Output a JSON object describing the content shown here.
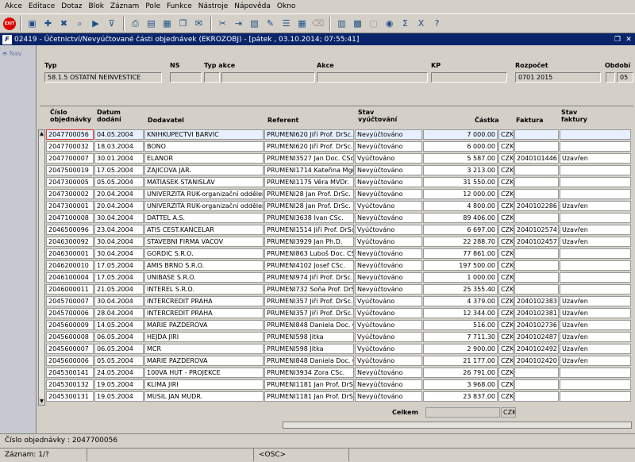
{
  "menu": [
    "Akce",
    "Editace",
    "Dotaz",
    "Blok",
    "Záznam",
    "Pole",
    "Funkce",
    "Nástroje",
    "Nápověda",
    "Okno"
  ],
  "toolbar_icons": [
    "exit-icon",
    "save-icon",
    "add-record-icon",
    "delete-record-icon",
    "search-icon",
    "execute-query-icon",
    "filter-icon",
    "print-icon",
    "report-icon",
    "preview-icon",
    "copy-icon",
    "email-icon",
    "cut-icon",
    "insert-icon",
    "paste-icon",
    "edit-icon",
    "list-icon",
    "table-icon",
    "clear-icon",
    "calendar-icon",
    "calculator-icon",
    "form-icon",
    "lock-icon",
    "sum-icon",
    "excel-icon",
    "help-icon"
  ],
  "window": {
    "logo": "F",
    "title": "02419 - Účetnictví/Nevyúčtované části objednávek (EKROZOBJ) - [pátek , 03.10.2014; 07:55:41]"
  },
  "nav": {
    "label": "Nav"
  },
  "header": {
    "typ_label": "Typ",
    "typ_value": "58.1.5 OSTATNÍ NEINVESTICE",
    "ns_label": "NS",
    "typ_akce_label": "Typ akce",
    "akce_label": "Akce",
    "kp_label": "KP",
    "rozpocet_label": "Rozpočet",
    "rozpocet_value": "0701 2015",
    "obdobi_label": "Období",
    "obdobi_value": "05"
  },
  "columns": {
    "cislo1": "Číslo",
    "cislo2": "objednávky",
    "datum1": "Datum",
    "datum2": "dodání",
    "dodavatel": "Dodavatel",
    "referent": "Referent",
    "stav1": "Stav",
    "stav2": "vyúčtování",
    "castka": "Částka",
    "faktura": "Faktura",
    "stavf1": "Stav",
    "stavf2": "faktury"
  },
  "rows": [
    {
      "cislo": "2047700056",
      "datum": "04.05.2004",
      "dodavatel": "KNIHKUPECTVI BARVIC",
      "referent": "PRUMENI620 Jiří Prof. DrSc.",
      "stav": "Nevyúčtováno",
      "castka": "7 000.00",
      "mena": "CZK",
      "faktura": "",
      "stavf": ""
    },
    {
      "cislo": "2047700032",
      "datum": "18.03.2004",
      "dodavatel": "BONO",
      "referent": "PRUMENI620 Jiří Prof. DrSc.",
      "stav": "Nevyúčtováno",
      "castka": "6 000.00",
      "mena": "CZK",
      "faktura": "",
      "stavf": ""
    },
    {
      "cislo": "2047700007",
      "datum": "30.01.2004",
      "dodavatel": "ELANOR",
      "referent": "PRUMENI3527 Jan Doc. CSc.",
      "stav": "Vyúčtováno",
      "castka": "5 587.00",
      "mena": "CZK",
      "faktura": "2040101446",
      "stavf": "Uzavřen"
    },
    {
      "cislo": "2047500019",
      "datum": "17.05.2004",
      "dodavatel": "ZAJICOVA JAR.",
      "referent": "PRUMENI1714 Kateřina Mgr.D",
      "stav": "Nevyúčtováno",
      "castka": "3 213.00",
      "mena": "CZK",
      "faktura": "",
      "stavf": ""
    },
    {
      "cislo": "2047300005",
      "datum": "05.05.2004",
      "dodavatel": "MATIASEK STANISLAV",
      "referent": "PRUMENI1175 Věra MVDr.",
      "stav": "Nevyúčtováno",
      "castka": "31 550.00",
      "mena": "CZK",
      "faktura": "",
      "stavf": ""
    },
    {
      "cislo": "2047300002",
      "datum": "20.04.2004",
      "dodavatel": "UNIVERZITA RUK-organizační oddělení",
      "referent": "PRUMENI28 Jan Prof. DrSc.",
      "stav": "Nevyúčtováno",
      "castka": "12 000.00",
      "mena": "CZK",
      "faktura": "",
      "stavf": ""
    },
    {
      "cislo": "2047300001",
      "datum": "20.04.2004",
      "dodavatel": "UNIVERZITA RUK-organizační oddělení",
      "referent": "PRUMENI28 Jan Prof. DrSc.",
      "stav": "Vyúčtováno",
      "castka": "4 800.00",
      "mena": "CZK",
      "faktura": "2040102286",
      "stavf": "Uzavřen"
    },
    {
      "cislo": "2047100008",
      "datum": "30.04.2004",
      "dodavatel": "DATTEL A.S.",
      "referent": "PRUMENI3638 Ivan CSc.",
      "stav": "Nevyúčtováno",
      "castka": "89 406.00",
      "mena": "CZK",
      "faktura": "",
      "stavf": ""
    },
    {
      "cislo": "2046500096",
      "datum": "23.04.2004",
      "dodavatel": "ATIS CEST.KANCELAR",
      "referent": "PRUMENI1514 Jiří Prof. DrSc.",
      "stav": "Vyúčtováno",
      "castka": "6 697.00",
      "mena": "CZK",
      "faktura": "2040102574",
      "stavf": "Uzavřen"
    },
    {
      "cislo": "2046300092",
      "datum": "30.04.2004",
      "dodavatel": "STAVEBNI FIRMA VACOV",
      "referent": "PRUMENI3929 Jan Ph.D.",
      "stav": "Vyúčtováno",
      "castka": "22 288.70",
      "mena": "CZK",
      "faktura": "2040102457",
      "stavf": "Uzavřen"
    },
    {
      "cislo": "2046300001",
      "datum": "30.04.2004",
      "dodavatel": "GORDIC S.R.O.",
      "referent": "PRUMENI863 Luboš Doc. CSc.",
      "stav": "Nevyúčtováno",
      "castka": "77 861.00",
      "mena": "CZK",
      "faktura": "",
      "stavf": ""
    },
    {
      "cislo": "2046200010",
      "datum": "17.05.2004",
      "dodavatel": "AMIS BRNO S.R.O.",
      "referent": "PRUMENI4102 Josef CSc.",
      "stav": "Nevyúčtováno",
      "castka": "197 500.00",
      "mena": "CZK",
      "faktura": "",
      "stavf": ""
    },
    {
      "cislo": "2046100004",
      "datum": "17.05.2004",
      "dodavatel": "UNIBASE S.R.O.",
      "referent": "PRUMENI974 Jiří Prof. DrSc.",
      "stav": "Nevyúčtováno",
      "castka": "1 000.00",
      "mena": "CZK",
      "faktura": "",
      "stavf": ""
    },
    {
      "cislo": "2046000011",
      "datum": "21.05.2004",
      "dodavatel": "INTEREL S.R.O.",
      "referent": "PRUMENI732 Soňa Prof. DrSc",
      "stav": "Nevyúčtováno",
      "castka": "25 355.40",
      "mena": "CZK",
      "faktura": "",
      "stavf": ""
    },
    {
      "cislo": "2045700007",
      "datum": "30.04.2004",
      "dodavatel": "INTERCREDIT PRAHA",
      "referent": "PRUMENI357 Jiří Prof. DrSc.",
      "stav": "Vyúčtováno",
      "castka": "4 379.00",
      "mena": "CZK",
      "faktura": "2040102383",
      "stavf": "Uzavřen"
    },
    {
      "cislo": "2045700006",
      "datum": "28.04.2004",
      "dodavatel": "INTERCREDIT PRAHA",
      "referent": "PRUMENI357 Jiří Prof. DrSc.",
      "stav": "Vyúčtováno",
      "castka": "12 344.00",
      "mena": "CZK",
      "faktura": "2040102381",
      "stavf": "Uzavřen"
    },
    {
      "cislo": "2045600009",
      "datum": "14.05.2004",
      "dodavatel": "MARIE PAZDEROVA",
      "referent": "PRUMENI848 Daniela Doc. CS",
      "stav": "Vyúčtováno",
      "castka": "516.00",
      "mena": "CZK",
      "faktura": "2040102736",
      "stavf": "Uzavřen"
    },
    {
      "cislo": "2045600008",
      "datum": "06.05.2004",
      "dodavatel": "HEJDA JIRI",
      "referent": "PRUMENI598 Jitka",
      "stav": "Vyúčtováno",
      "castka": "7 711.30",
      "mena": "CZK",
      "faktura": "2040102487",
      "stavf": "Uzavřen"
    },
    {
      "cislo": "2045600007",
      "datum": "06.05.2004",
      "dodavatel": "MCR",
      "referent": "PRUMENI598 Jitka",
      "stav": "Vyúčtováno",
      "castka": "2 900.00",
      "mena": "CZK",
      "faktura": "2040102492",
      "stavf": "Uzavřen"
    },
    {
      "cislo": "2045600006",
      "datum": "05.05.2004",
      "dodavatel": "MARIE PAZDEROVA",
      "referent": "PRUMENI848 Daniela Doc. CS",
      "stav": "Vyúčtováno",
      "castka": "21 177.00",
      "mena": "CZK",
      "faktura": "2040102420",
      "stavf": "Uzavřen"
    },
    {
      "cislo": "2045300141",
      "datum": "24.05.2004",
      "dodavatel": "100VA HUT - PROJEKCE",
      "referent": "PRUMENI3934 Zora CSc.",
      "stav": "Nevyúčtováno",
      "castka": "26 791.00",
      "mena": "CZK",
      "faktura": "",
      "stavf": ""
    },
    {
      "cislo": "2045300132",
      "datum": "19.05.2004",
      "dodavatel": "KLIMA JIRI",
      "referent": "PRUMENI1181 Jan Prof. DrSc.",
      "stav": "Nevyúčtováno",
      "castka": "3 968.00",
      "mena": "CZK",
      "faktura": "",
      "stavf": ""
    },
    {
      "cislo": "2045300131",
      "datum": "19.05.2004",
      "dodavatel": "MUSIL JAN MUDR.",
      "referent": "PRUMENI1181 Jan Prof. DrSc.",
      "stav": "Nevyúčtováno",
      "castka": "23 837.00",
      "mena": "CZK",
      "faktura": "",
      "stavf": ""
    }
  ],
  "total": {
    "label": "Celkem",
    "value": "",
    "mena": "CZK"
  },
  "status": {
    "field_info": "Číslo objednávky : 2047700056",
    "record": "Záznam: 1/?",
    "osc": "<OSC>"
  }
}
